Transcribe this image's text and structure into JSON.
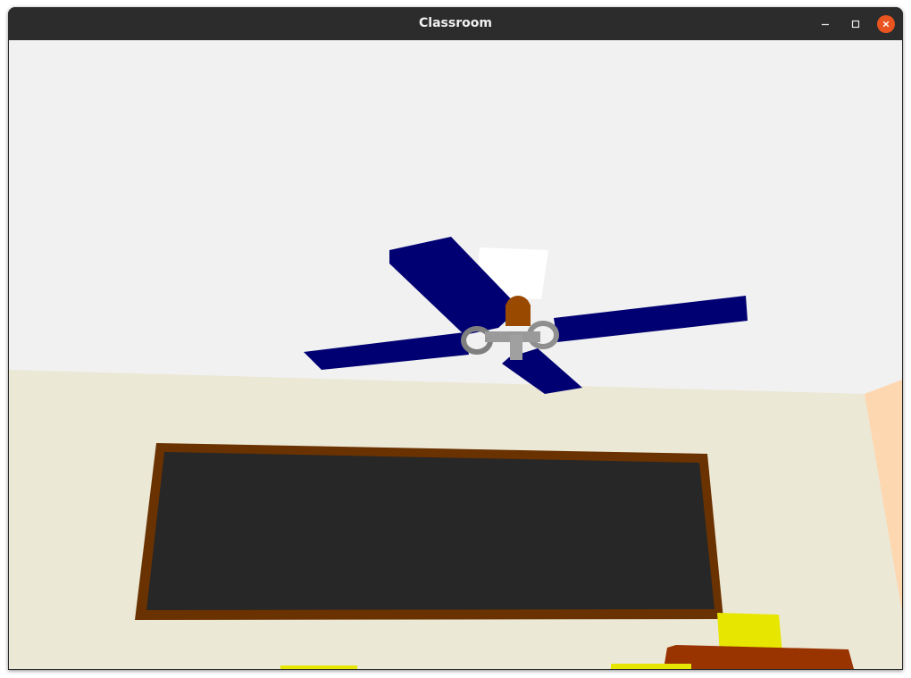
{
  "window": {
    "title": "Classroom",
    "controls": {
      "minimize_icon": "minimize-icon",
      "maximize_icon": "maximize-icon",
      "close_icon": "close-icon"
    }
  },
  "scene": {
    "colors": {
      "ceiling": "#f1f1f1",
      "wall": "#ece8d6",
      "side_wall": "#fdd7b0",
      "fan_blade": "#000073",
      "fan_hub": "#9a4a00",
      "fan_metal": "#8a8a8a",
      "light_panel": "#ffffff",
      "board_frame": "#6a3200",
      "board_surface": "#272727",
      "table": "#993300",
      "chair_yellow": "#e6e600"
    }
  }
}
